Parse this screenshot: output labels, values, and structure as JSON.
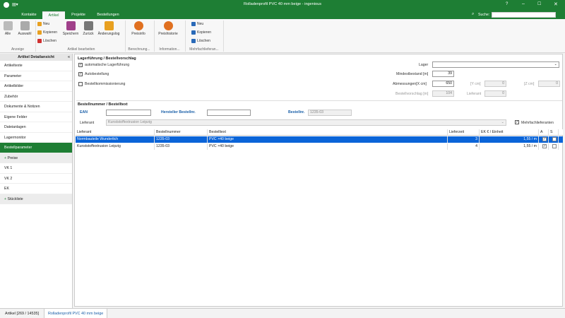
{
  "app": {
    "title": "Rolladenprofil PVC 40 mm beige - ingenious",
    "tabs": [
      "Kontakte",
      "Artikel",
      "Projekte",
      "Bestellungen"
    ],
    "search_label": "Suche:",
    "search_value": ""
  },
  "ribbon": {
    "alle": "Alle",
    "auswahl": "Auswahl",
    "neu": "Neu",
    "kopieren": "Kopieren",
    "loeschen": "Löschen",
    "speichern": "Speichern",
    "zurueck": "Zurück",
    "aenderungslog": "Änderungslog",
    "preisinfo": "Preisinfo",
    "preishistorie": "Preishistorie",
    "neu2": "Neu",
    "kopieren2": "Kopieren",
    "loeschen2": "Löschen",
    "groups": {
      "anzeige": "Anzeige",
      "bearbeiten": "Artikel bearbeiten",
      "berechnung": "Berechnung...",
      "information": "Information...",
      "mehrfach": "Mehrfachlieferan..."
    }
  },
  "sidebar": {
    "header": "Artikel Detailansicht",
    "items": [
      "Artikeltexte",
      "Parameter",
      "Artikelbilder",
      "Zubehör",
      "Dokumente & Notizen",
      "Eigene Felder",
      "Dateianlagen",
      "Lagermonitor",
      "Bestellparameter",
      "Preise",
      "VK 1",
      "VK 2",
      "EK",
      "Stückliste"
    ]
  },
  "lager": {
    "section": "Lagerführung / Bestellvorschlag",
    "auto_lager": "automatische Lagerführung",
    "auto_lager_checked": true,
    "autobestellung": "Autobestellung",
    "autobestellung_checked": true,
    "bestellkommission": "Bestellkommissionierung",
    "bestellkommission_checked": false,
    "lager_label": "Lager",
    "lager_value": "",
    "mindest_label": "Mindestbestand [m]",
    "mindest_value": "39",
    "abmessungen_label": "Abmessungen[X cm]",
    "abmessungen_value": "650",
    "y_label": "[Y cm]",
    "y_value": "0",
    "z_label": "[Z cm]",
    "z_value": "0",
    "vorschlag_label": "Bestellvorschlag [m]",
    "vorschlag_value": "104",
    "lieferant_label": "Lieferant",
    "lieferant_value": "0"
  },
  "bestell": {
    "section": "Bestellnummer / Bestelltext",
    "ean_label": "EAN",
    "ean_value": "",
    "hersteller_label": "Hersteller Bestellnr.",
    "hersteller_value": "",
    "bestellnr_label": "Bestellnr.",
    "bestellnr_value": "1235-03",
    "lieferant_label": "Lieferant",
    "lieferant_value": "Kunststoffextrusion Leipzig",
    "mehrfach_label": "Mehrfachlieferanten",
    "mehrfach_checked": true
  },
  "grid": {
    "headers": [
      "Lieferant",
      "Bestellnummer",
      "Bestelltext",
      "Lieferzeit",
      "EK € / Einheit",
      "A",
      "S"
    ],
    "rows": [
      {
        "lieferant": "Normbauteile Wunderlich",
        "nummer": "1235-03",
        "text": "PVC ×40 beige",
        "zeit": "3",
        "ek": "1,55 / m",
        "a": true,
        "s": false
      },
      {
        "lieferant": "Kunststoffextrusion Leipzig",
        "nummer": "1235-03",
        "text": "PVC ×40 beige",
        "zeit": "4",
        "ek": "1,55 / m",
        "a": true,
        "s": false
      }
    ]
  },
  "status": {
    "tab1": "Artikel [269 / 14535]",
    "tab2": "Rolladenprofil PVC 40 mm beige"
  },
  "colors": {
    "brand": "#1e7e34",
    "selection": "#0a64d8"
  }
}
